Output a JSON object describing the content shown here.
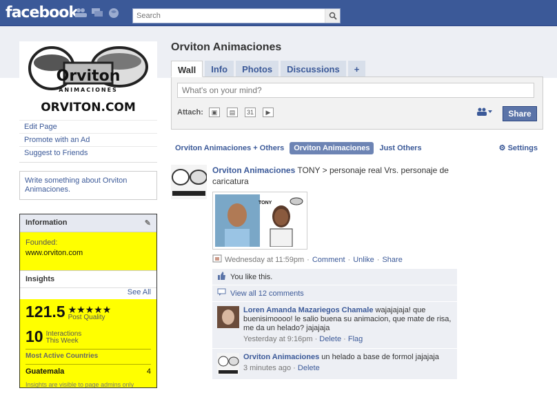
{
  "header": {
    "logo": "facebook",
    "search_placeholder": "Search"
  },
  "left": {
    "logo_text_main": "Orviton",
    "logo_text_sub": "ANIMACIONES",
    "logo_text_url": "ORVITON.COM",
    "links": [
      "Edit Page",
      "Promote with an Ad",
      "Suggest to Friends"
    ],
    "write_something": "Write something about Orviton Animaciones.",
    "information": {
      "title": "Information",
      "founded_label": "Founded:",
      "founded_value": "www.orviton.com"
    },
    "insights": {
      "title": "Insights",
      "see_all": "See All",
      "post_quality_value": "121.5",
      "stars": "★★★★★",
      "post_quality_label": "Post Quality",
      "interactions_value": "10",
      "interactions_label_1": "Interactions",
      "interactions_label_2": "This Week",
      "most_active_label": "Most Active Countries",
      "country": "Guatemala",
      "country_count": "4",
      "fine_print": "Insights are visible to page admins only"
    }
  },
  "main": {
    "title": "Orviton Animaciones",
    "tabs": [
      "Wall",
      "Info",
      "Photos",
      "Discussions",
      "+"
    ],
    "composer": {
      "placeholder": "What's on your mind?",
      "attach_label": "Attach:",
      "share_label": "Share"
    },
    "filters": [
      "Orviton Animaciones + Others",
      "Orviton Animaciones",
      "Just Others"
    ],
    "settings": "Settings",
    "story": {
      "author": "Orviton Animaciones",
      "text": "TONY > personaje real Vrs. personaje de caricatura",
      "photo_caption": "TONY",
      "time": "Wednesday at 11:59pm",
      "comment": "Comment",
      "unlike": "Unlike",
      "share": "Share",
      "sep": "·",
      "likes": "You like this.",
      "view_all": "View all 12 comments"
    },
    "comments": [
      {
        "author": "Loren Amanda Mazariegos Chamale",
        "text": "wajajajaja! que buenisimoooo! le salio buena su animacion, que mate de risa, me da un helado? jajajaja",
        "time": "Yesterday at 9:16pm",
        "delete": "Delete",
        "flag": "Flag"
      },
      {
        "author": "Orviton Animaciones",
        "text": "un helado a base de formol jajajaja",
        "time": "3 minutes ago",
        "delete": "Delete"
      }
    ]
  }
}
